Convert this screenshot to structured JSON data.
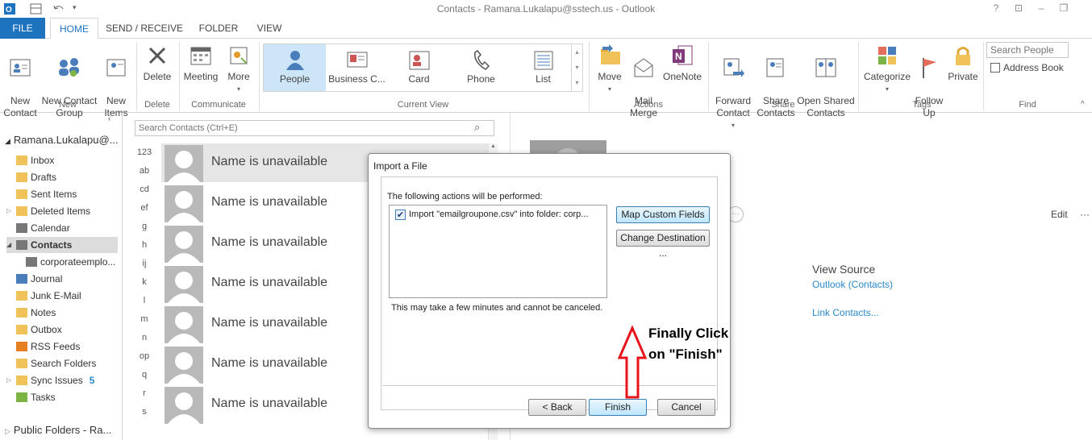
{
  "window": {
    "title": "Contacts - Ramana.Lukalapu@sstech.us - Outlook",
    "help": "?",
    "restore": "⊡",
    "minimize": "–",
    "maximize": "❐"
  },
  "tabs": [
    "FILE",
    "HOME",
    "SEND / RECEIVE",
    "FOLDER",
    "VIEW"
  ],
  "ribbon": {
    "new_contact": "New\nContact",
    "new_contact_group": "New Contact\nGroup",
    "new_items": "New\nItems",
    "delete": "Delete",
    "meeting": "Meeting",
    "more": "More",
    "groups": {
      "new": "New",
      "delete": "Delete",
      "communicate": "Communicate",
      "current_view": "Current View",
      "actions": "Actions",
      "share": "Share",
      "tags": "Tags",
      "find": "Find"
    },
    "views": [
      "People",
      "Business C...",
      "Card",
      "Phone",
      "List"
    ],
    "move": "Move",
    "mail_merge": "Mail\nMerge",
    "onenote": "OneNote",
    "forward_contact": "Forward\nContact",
    "share_contacts": "Share\nContacts",
    "open_shared_contacts": "Open Shared\nContacts",
    "categorize": "Categorize",
    "follow_up": "Follow\nUp",
    "private": "Private",
    "search_people_placeholder": "Search People",
    "address_book": "Address Book"
  },
  "folders": {
    "account": "Ramana.Lukalapu@...",
    "items": [
      "Inbox",
      "Drafts",
      "Sent Items",
      "Deleted Items",
      "Calendar",
      "Contacts",
      "corporateemplo...",
      "Journal",
      "Junk E-Mail",
      "Notes",
      "Outbox",
      "RSS Feeds",
      "Search Folders",
      "Sync Issues",
      "Tasks"
    ],
    "sync_issues_count": "5",
    "public_folders": "Public Folders - Ra..."
  },
  "contacts": {
    "search_placeholder": "Search Contacts (Ctrl+E)",
    "alpha_index": [
      "123",
      "ab",
      "cd",
      "ef",
      "g",
      "h",
      "ij",
      "k",
      "l",
      "m",
      "n",
      "op",
      "q",
      "r",
      "s"
    ],
    "names": [
      "Name is unavailable",
      "Name is unavailable",
      "Name is unavailable",
      "Name is unavailable",
      "Name is unavailable",
      "Name is unavailable",
      "Name is unavailable"
    ]
  },
  "reading": {
    "edit": "Edit",
    "more": "···",
    "view_source_heading": "View Source",
    "view_source_link": "Outlook (Contacts)",
    "link_contacts": "Link Contacts..."
  },
  "dialog": {
    "title": "Import a File",
    "actions_label": "The following actions will be performed:",
    "action_item": "Import \"emailgroupone.csv\" into folder: corp...",
    "map_custom_fields": "Map Custom Fields ...",
    "change_destination": "Change Destination ...",
    "note": "This may take a few minutes and cannot be canceled.",
    "back": "< Back",
    "finish": "Finish",
    "cancel": "Cancel"
  },
  "annotation": {
    "text_line1": "Finally Click",
    "text_line2": "on \"Finish\""
  },
  "colors": {
    "accent": "#1e73be",
    "link": "#2a88c8",
    "selected_view": "#cde6f7",
    "annotation_arrow": "#e8141b"
  }
}
